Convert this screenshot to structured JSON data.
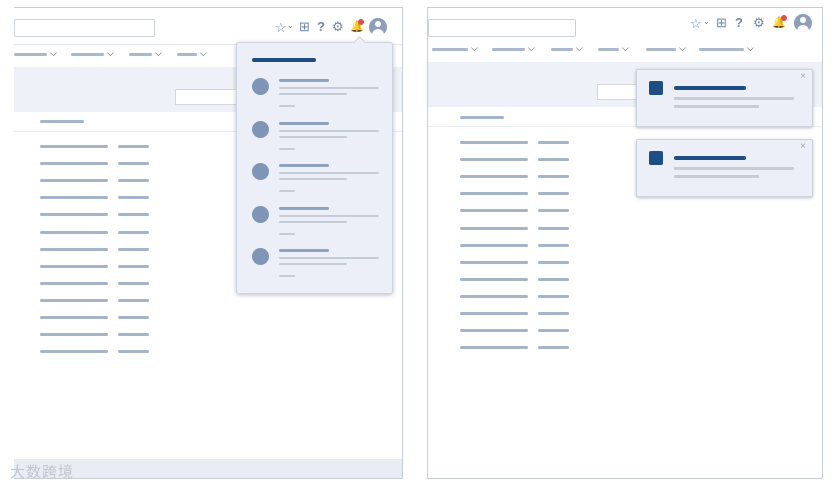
{
  "left_window": {
    "icons": [
      "star-icon",
      "chevron-down-icon",
      "plus-square-icon",
      "help-icon",
      "gear-icon",
      "bell-icon",
      "user-avatar-icon"
    ],
    "notifications_badge": "unread",
    "dropdown": {
      "title_placeholder": "notifications-title",
      "item_count": 5
    }
  },
  "right_window": {
    "icons": [
      "star-icon",
      "chevron-down-icon",
      "plus-square-icon",
      "help-icon",
      "gear-icon",
      "bell-icon",
      "user-avatar-icon"
    ],
    "toasts": [
      {
        "close_label": "×"
      },
      {
        "close_label": "×"
      }
    ]
  },
  "glyphs": {
    "star": "☆",
    "chevron": "⌄",
    "plus": "⊞",
    "help": "?",
    "gear": "⚙",
    "bell": "🔔",
    "nav_chevron": "⌵"
  },
  "watermark": "大数跨境",
  "colors": {
    "accent": "#1e4d85",
    "badge": "#d9534f",
    "placeholder_line": "#a6b4c8",
    "panel_bg": "#eceff7"
  }
}
